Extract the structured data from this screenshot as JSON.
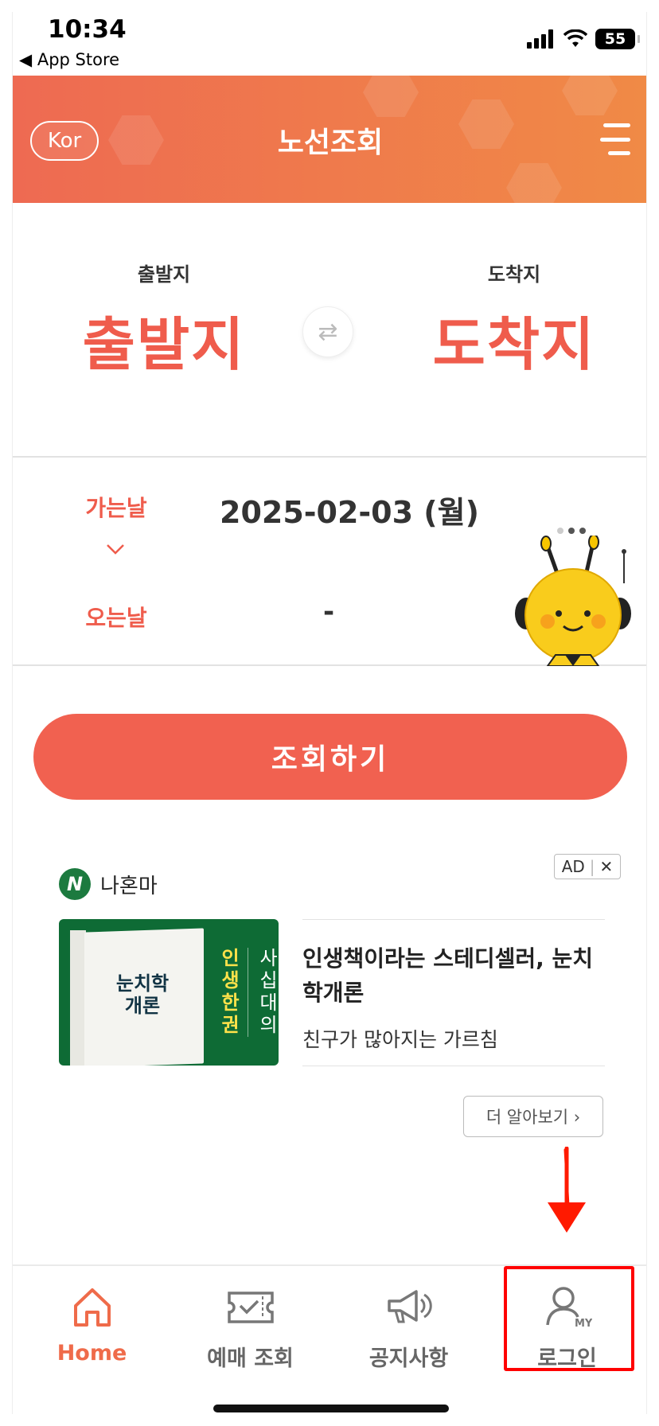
{
  "status_bar": {
    "time": "10:34",
    "back_app": "◀ App Store",
    "battery": "55"
  },
  "header": {
    "lang_button": "Kor",
    "title": "노선조회"
  },
  "route": {
    "departure_label": "출발지",
    "departure_value": "출발지",
    "arrival_label": "도착지",
    "arrival_value": "도착지",
    "swap_symbol": "⇄"
  },
  "dates": {
    "go_label": "가는날",
    "go_value": "2025-02-03 (월)",
    "return_label": "오는날",
    "return_value": "-"
  },
  "search_button": "조회하기",
  "ad": {
    "badge_text": "AD",
    "close_symbol": "✕",
    "brand_logo": "N",
    "brand_name": "나혼마",
    "book_title_line1": "눈치학",
    "book_title_line2": "개론",
    "side_col1": "인생한권",
    "side_col2": "사십대의",
    "headline": "인생책이라는 스테디셀러, 눈치학개론",
    "subtext": "친구가 많아지는 가르침",
    "more_button": "더 알아보기 ›"
  },
  "tabbar": {
    "tabs": [
      {
        "label": "Home",
        "icon": "home-icon",
        "active": true
      },
      {
        "label": "예매 조회",
        "icon": "ticket-icon",
        "active": false
      },
      {
        "label": "공지사항",
        "icon": "megaphone-icon",
        "active": false
      },
      {
        "label": "로그인",
        "icon": "user-my-icon",
        "active": false
      }
    ]
  },
  "colors": {
    "accent": "#f16150",
    "header_start": "#ee6a52",
    "header_end": "#f08a46",
    "active_tab": "#ef6b4a",
    "annotation": "#ff0000"
  }
}
